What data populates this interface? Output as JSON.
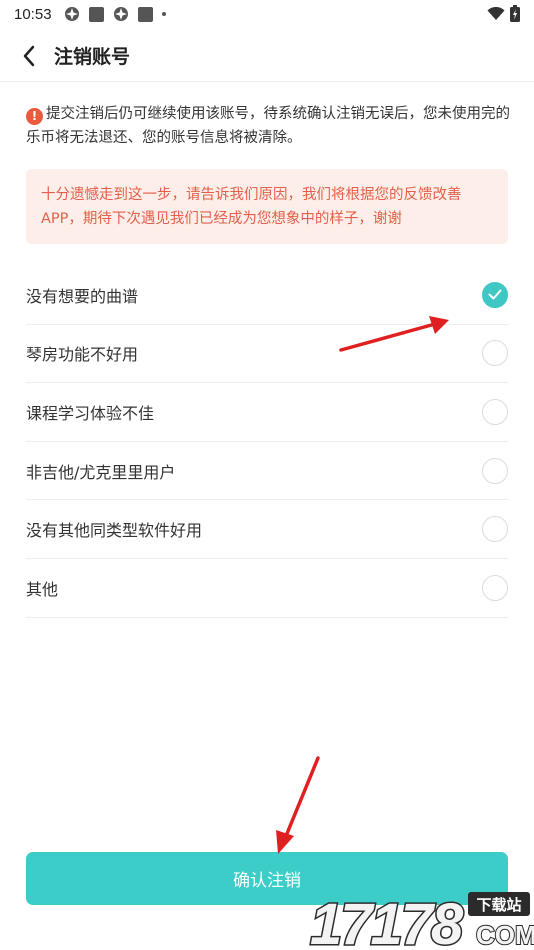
{
  "status_bar": {
    "time": "10:53"
  },
  "header": {
    "title": "注销账号"
  },
  "notice": {
    "text": "提交注销后仍可继续使用该账号，待系统确认注销无误后，您未使用完的乐币将无法退还、您的账号信息将被清除。"
  },
  "feedback_prompt": {
    "text": "十分遗憾走到这一步，请告诉我们原因，我们将根据您的反馈改善APP，期待下次遇见我们已经成为您想象中的样子，谢谢"
  },
  "reasons": [
    {
      "label": "没有想要的曲谱",
      "checked": true
    },
    {
      "label": "琴房功能不好用",
      "checked": false
    },
    {
      "label": "课程学习体验不佳",
      "checked": false
    },
    {
      "label": "非吉他/尤克里里用户",
      "checked": false
    },
    {
      "label": "没有其他同类型软件好用",
      "checked": false
    },
    {
      "label": "其他",
      "checked": false
    }
  ],
  "confirm_button": {
    "label": "确认注销"
  },
  "watermark": {
    "number": "17178",
    "tag": "下载站",
    "domain": "COM"
  },
  "colors": {
    "accent": "#3ccdc9",
    "warning": "#ea5a3c",
    "prompt_bg": "#fdeeea",
    "prompt_text": "#e4604a",
    "annotation_arrow": "#e02020"
  },
  "icons": {
    "back": "chevron-left-icon",
    "warning": "exclamation-circle-icon",
    "check": "checkmark-icon"
  }
}
